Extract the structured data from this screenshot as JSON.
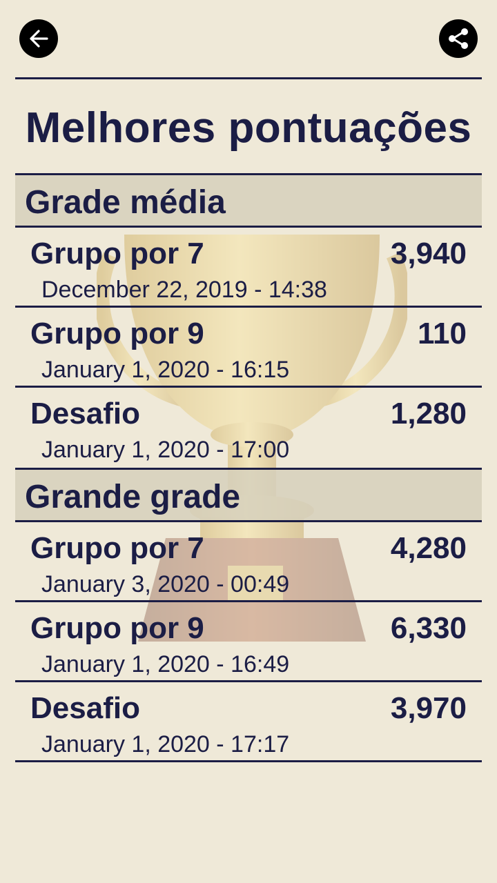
{
  "header": {
    "back_icon": "arrow-left-icon",
    "share_icon": "share-icon"
  },
  "title": "Melhores pontuações",
  "sections": [
    {
      "label": "Grade média",
      "rows": [
        {
          "mode": "Grupo por 7",
          "score": "3,940",
          "date": "December 22, 2019 - 14:38"
        },
        {
          "mode": "Grupo por 9",
          "score": "110",
          "date": "January 1, 2020 - 16:15"
        },
        {
          "mode": "Desafio",
          "score": "1,280",
          "date": "January 1, 2020 - 17:00"
        }
      ]
    },
    {
      "label": "Grande grade",
      "rows": [
        {
          "mode": "Grupo por 7",
          "score": "4,280",
          "date": "January 3, 2020 - 00:49"
        },
        {
          "mode": "Grupo por 9",
          "score": "6,330",
          "date": "January 1, 2020 - 16:49"
        },
        {
          "mode": "Desafio",
          "score": "3,970",
          "date": "January 1, 2020 - 17:17"
        }
      ]
    }
  ],
  "colors": {
    "background": "#efe9d8",
    "text": "#1b1d45",
    "section_band": "#d6d0bc"
  }
}
